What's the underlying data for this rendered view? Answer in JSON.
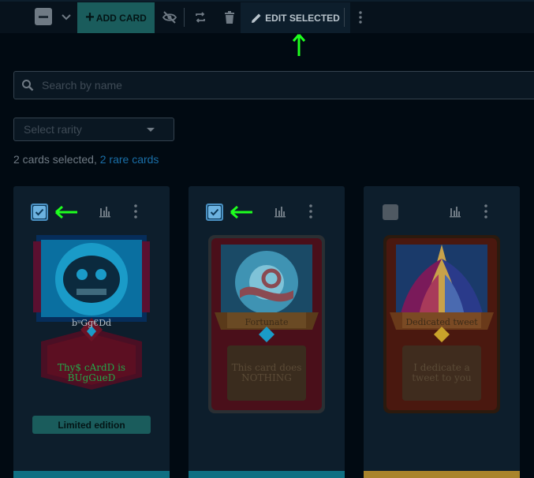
{
  "toolbar": {
    "add_card_label": "ADD CARD",
    "edit_selected_label": "EDIT SELECTED"
  },
  "search": {
    "placeholder": "Search by name"
  },
  "rarity": {
    "placeholder": "Select rarity"
  },
  "selection": {
    "count_text": "2 cards selected,",
    "rare_link_text": "2 rare cards"
  },
  "cards": [
    {
      "name": "bᵘGg€Dd",
      "description": "Thy$ cArdD is BUgGueD",
      "checked": true,
      "badge": "Limited edition",
      "strip_color": "#0f6f82"
    },
    {
      "name": "Fortunate",
      "description": "This card does NOTHING",
      "checked": true,
      "badge": "",
      "strip_color": "#0f6f82"
    },
    {
      "name": "Dedicated tweet",
      "description": "I dedicate a tweet to you",
      "checked": false,
      "badge": "",
      "strip_color": "#a9842c"
    }
  ],
  "colors": {
    "background": "#010a12",
    "panel": "#0d1e2c",
    "accent_teal": "#1a5c5c",
    "link_blue": "#1a6fa8",
    "annotation_green": "#1eff1e"
  }
}
